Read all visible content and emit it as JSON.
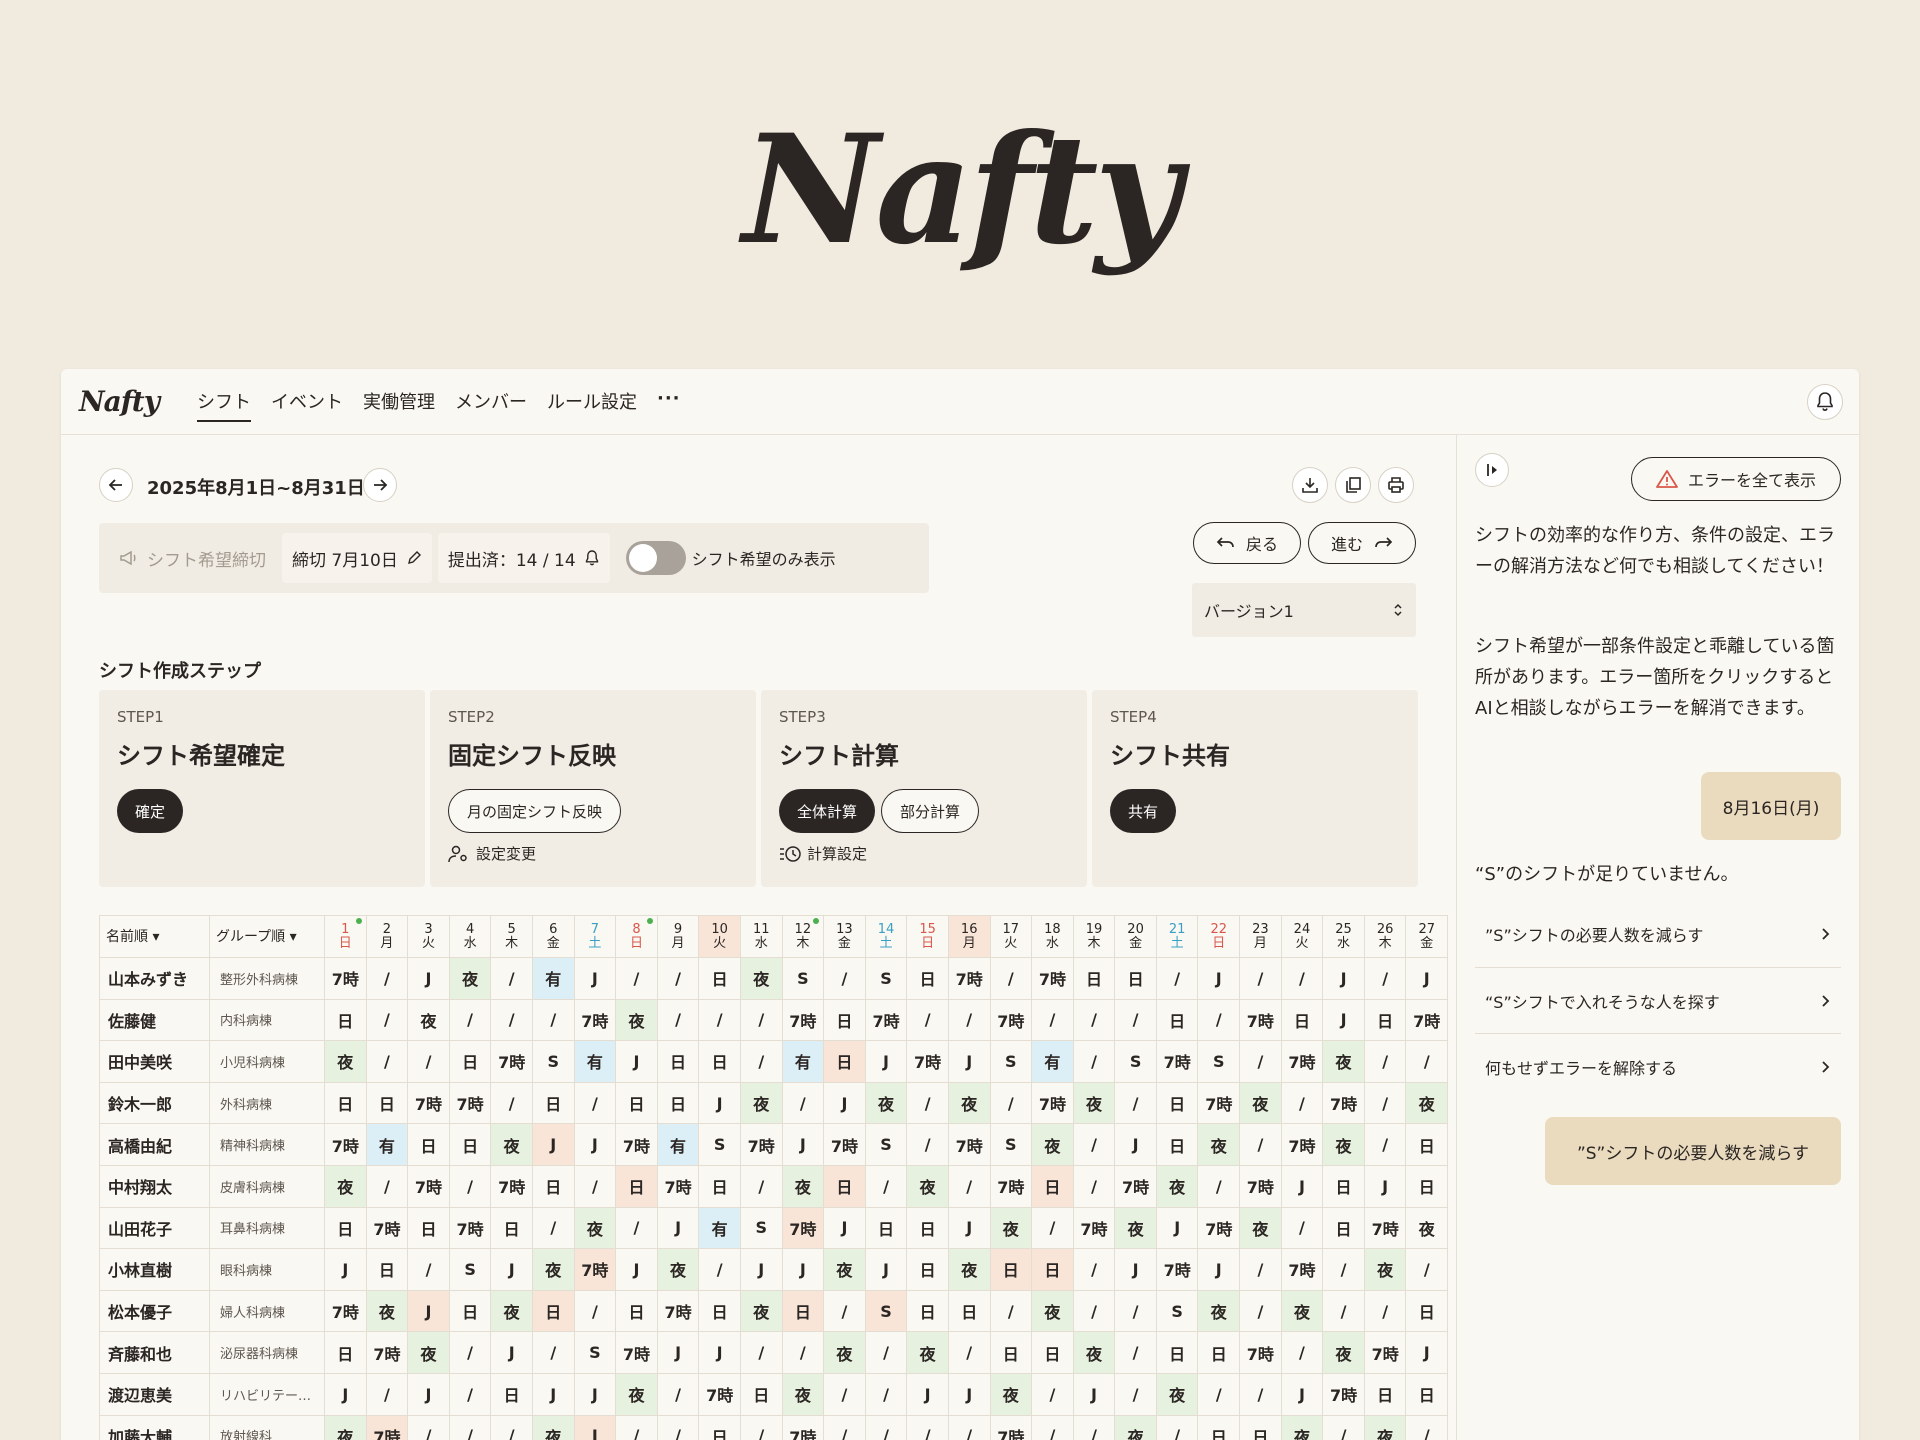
{
  "hero_logo": "Nafty",
  "app": {
    "logo": "Nafty",
    "nav": [
      "シフト",
      "イベント",
      "実働管理",
      "メンバー",
      "ルール設定",
      "···"
    ],
    "date_range": "2025年8月1日~8月31日",
    "info": {
      "deadline_label": "シフト希望締切",
      "deadline_value": "締切  7月10日",
      "submitted": "提出済：14 / 14",
      "toggle_label": "シフト希望のみ表示"
    },
    "undo_label": "戻る",
    "redo_label": "進む",
    "version": "バージョン1",
    "steps_title": "シフト作成ステップ",
    "steps": [
      {
        "label": "STEP1",
        "title": "シフト希望確定",
        "buttons": [
          {
            "text": "確定",
            "style": "dark"
          }
        ],
        "sub": ""
      },
      {
        "label": "STEP2",
        "title": "固定シフト反映",
        "buttons": [
          {
            "text": "月の固定シフト反映",
            "style": "light"
          }
        ],
        "sub": "設定変更"
      },
      {
        "label": "STEP3",
        "title": "シフト計算",
        "buttons": [
          {
            "text": "全体計算",
            "style": "dark"
          },
          {
            "text": "部分計算",
            "style": "light"
          }
        ],
        "sub": "計算設定"
      },
      {
        "label": "STEP4",
        "title": "シフト共有",
        "buttons": [
          {
            "text": "共有",
            "style": "dark"
          }
        ],
        "sub": ""
      }
    ],
    "table": {
      "sort_name": "名前順 ▾",
      "sort_group": "グループ順 ▾",
      "days": [
        {
          "d": "1",
          "w": "日",
          "type": "sun",
          "dot": true
        },
        {
          "d": "2",
          "w": "月"
        },
        {
          "d": "3",
          "w": "火"
        },
        {
          "d": "4",
          "w": "水"
        },
        {
          "d": "5",
          "w": "木"
        },
        {
          "d": "6",
          "w": "金"
        },
        {
          "d": "7",
          "w": "土",
          "type": "sat"
        },
        {
          "d": "8",
          "w": "日",
          "type": "sun",
          "dot": true
        },
        {
          "d": "9",
          "w": "月"
        },
        {
          "d": "10",
          "w": "火",
          "hl": true
        },
        {
          "d": "11",
          "w": "水"
        },
        {
          "d": "12",
          "w": "木",
          "dot": true
        },
        {
          "d": "13",
          "w": "金"
        },
        {
          "d": "14",
          "w": "土",
          "type": "sat"
        },
        {
          "d": "15",
          "w": "日",
          "type": "sun"
        },
        {
          "d": "16",
          "w": "月",
          "hl": true
        },
        {
          "d": "17",
          "w": "火"
        },
        {
          "d": "18",
          "w": "水"
        },
        {
          "d": "19",
          "w": "木"
        },
        {
          "d": "20",
          "w": "金"
        },
        {
          "d": "21",
          "w": "土",
          "type": "sat"
        },
        {
          "d": "22",
          "w": "日",
          "type": "sun"
        },
        {
          "d": "23",
          "w": "月"
        },
        {
          "d": "24",
          "w": "火"
        },
        {
          "d": "25",
          "w": "水"
        },
        {
          "d": "26",
          "w": "木"
        },
        {
          "d": "27",
          "w": "金"
        }
      ],
      "rows": [
        {
          "name": "山本みずき",
          "group": "整形外科病棟",
          "cells": [
            "7時",
            "/",
            "J",
            "夜",
            "/",
            "有",
            "J",
            "/",
            "/",
            "日",
            "夜",
            "S",
            "/",
            "S",
            "日",
            "7時",
            "/",
            "7時",
            "日",
            "日",
            "/",
            "J",
            "/",
            "/",
            "J",
            "/",
            "J"
          ],
          "colors": [
            "",
            "",
            "",
            "g",
            "",
            "b",
            "",
            "",
            "",
            "",
            "g",
            "",
            "",
            "",
            "",
            "",
            "",
            "",
            "",
            "",
            "",
            "",
            "",
            "",
            "",
            "",
            ""
          ]
        },
        {
          "name": "佐藤健",
          "group": "内科病棟",
          "cells": [
            "日",
            "/",
            "夜",
            "/",
            "/",
            "/",
            "7時",
            "夜",
            "/",
            "/",
            "/",
            "7時",
            "日",
            "7時",
            "/",
            "/",
            "7時",
            "/",
            "/",
            "/",
            "日",
            "/",
            "7時",
            "日",
            "J",
            "日",
            "7時"
          ],
          "colors": [
            "",
            "",
            "",
            "",
            "",
            "",
            "",
            "g",
            "",
            "",
            "",
            "",
            "",
            "",
            "",
            "",
            "",
            "",
            "",
            "",
            "",
            "",
            "",
            "",
            "",
            "",
            ""
          ]
        },
        {
          "name": "田中美咲",
          "group": "小児科病棟",
          "cells": [
            "夜",
            "/",
            "/",
            "日",
            "7時",
            "S",
            "有",
            "J",
            "日",
            "日",
            "/",
            "有",
            "日",
            "J",
            "7時",
            "J",
            "S",
            "有",
            "/",
            "S",
            "7時",
            "S",
            "/",
            "7時",
            "夜",
            "/",
            "/"
          ],
          "colors": [
            "g",
            "",
            "",
            "",
            "",
            "",
            "b",
            "",
            "",
            "",
            "",
            "b",
            "p",
            "",
            "",
            "",
            "",
            "b",
            "",
            "",
            "",
            "",
            "",
            "",
            "g",
            "",
            ""
          ]
        },
        {
          "name": "鈴木一郎",
          "group": "外科病棟",
          "cells": [
            "日",
            "日",
            "7時",
            "7時",
            "/",
            "日",
            "/",
            "日",
            "日",
            "J",
            "夜",
            "/",
            "J",
            "夜",
            "/",
            "夜",
            "/",
            "7時",
            "夜",
            "/",
            "日",
            "7時",
            "夜",
            "/",
            "7時",
            "/",
            "夜"
          ],
          "colors": [
            "",
            "",
            "",
            "",
            "",
            "",
            "",
            "",
            "",
            "",
            "g",
            "",
            "",
            "g",
            "",
            "g",
            "",
            "",
            "g",
            "",
            "",
            "",
            "g",
            "",
            "",
            "",
            "g"
          ]
        },
        {
          "name": "高橋由紀",
          "group": "精神科病棟",
          "cells": [
            "7時",
            "有",
            "日",
            "日",
            "夜",
            "J",
            "J",
            "7時",
            "有",
            "S",
            "7時",
            "J",
            "7時",
            "S",
            "/",
            "7時",
            "S",
            "夜",
            "/",
            "J",
            "日",
            "夜",
            "/",
            "7時",
            "夜",
            "/",
            "日"
          ],
          "colors": [
            "",
            "b",
            "",
            "",
            "g",
            "p",
            "",
            "",
            "b",
            "",
            "",
            "",
            "",
            "",
            "",
            "",
            "",
            "g",
            "",
            "",
            "",
            "g",
            "",
            "",
            "g",
            "",
            ""
          ]
        },
        {
          "name": "中村翔太",
          "group": "皮膚科病棟",
          "cells": [
            "夜",
            "/",
            "7時",
            "/",
            "7時",
            "日",
            "/",
            "日",
            "7時",
            "日",
            "/",
            "夜",
            "日",
            "/",
            "夜",
            "/",
            "7時",
            "日",
            "/",
            "7時",
            "夜",
            "/",
            "7時",
            "J",
            "日",
            "J",
            "日"
          ],
          "colors": [
            "g",
            "",
            "",
            "",
            "",
            "",
            "",
            "p",
            "",
            "",
            "",
            "g",
            "p",
            "",
            "g",
            "",
            "",
            "p",
            "",
            "",
            "g",
            "",
            "",
            "",
            "",
            "",
            ""
          ]
        },
        {
          "name": "山田花子",
          "group": "耳鼻科病棟",
          "cells": [
            "日",
            "7時",
            "日",
            "7時",
            "日",
            "/",
            "夜",
            "/",
            "J",
            "有",
            "S",
            "7時",
            "J",
            "日",
            "日",
            "J",
            "夜",
            "/",
            "7時",
            "夜",
            "J",
            "7時",
            "夜",
            "/",
            "日",
            "7時",
            "夜"
          ],
          "colors": [
            "",
            "",
            "",
            "",
            "",
            "",
            "g",
            "",
            "",
            "b",
            "",
            "p",
            "",
            "",
            "",
            "",
            "g",
            "",
            "",
            "g",
            "",
            "",
            "g",
            "",
            "",
            "",
            ""
          ]
        },
        {
          "name": "小林直樹",
          "group": "眼科病棟",
          "cells": [
            "J",
            "日",
            "/",
            "S",
            "J",
            "夜",
            "7時",
            "J",
            "夜",
            "/",
            "J",
            "J",
            "夜",
            "J",
            "日",
            "夜",
            "日",
            "日",
            "/",
            "J",
            "7時",
            "J",
            "/",
            "7時",
            "/",
            "夜",
            "/"
          ],
          "colors": [
            "",
            "",
            "",
            "",
            "",
            "g",
            "p",
            "",
            "g",
            "",
            "",
            "",
            "g",
            "",
            "",
            "g",
            "p",
            "p",
            "",
            "",
            "",
            "",
            "",
            "",
            "",
            "g",
            ""
          ]
        },
        {
          "name": "松本優子",
          "group": "婦人科病棟",
          "cells": [
            "7時",
            "夜",
            "J",
            "日",
            "夜",
            "日",
            "/",
            "日",
            "7時",
            "日",
            "夜",
            "日",
            "/",
            "S",
            "日",
            "日",
            "/",
            "夜",
            "/",
            "/",
            "S",
            "夜",
            "/",
            "夜",
            "/",
            "/",
            "日"
          ],
          "colors": [
            "",
            "g",
            "p",
            "",
            "g",
            "p",
            "",
            "",
            "",
            "",
            "g",
            "p",
            "",
            "p",
            "",
            "",
            "",
            "g",
            "",
            "",
            "",
            "g",
            "",
            "g",
            "",
            "",
            ""
          ]
        },
        {
          "name": "斉藤和也",
          "group": "泌尿器科病棟",
          "cells": [
            "日",
            "7時",
            "夜",
            "/",
            "J",
            "/",
            "S",
            "7時",
            "J",
            "J",
            "/",
            "/",
            "夜",
            "/",
            "夜",
            "/",
            "日",
            "日",
            "夜",
            "/",
            "日",
            "日",
            "7時",
            "/",
            "夜",
            "7時",
            "J"
          ],
          "colors": [
            "",
            "",
            "g",
            "",
            "",
            "",
            "",
            "",
            "",
            "",
            "",
            "",
            "g",
            "",
            "g",
            "",
            "",
            "",
            "g",
            "",
            "",
            "",
            "",
            "",
            "g",
            "",
            ""
          ]
        },
        {
          "name": "渡辺恵美",
          "group": "リハビリテー…",
          "cells": [
            "J",
            "/",
            "J",
            "/",
            "日",
            "J",
            "J",
            "夜",
            "/",
            "7時",
            "日",
            "夜",
            "/",
            "/",
            "J",
            "J",
            "夜",
            "/",
            "J",
            "/",
            "夜",
            "/",
            "/",
            "J",
            "7時",
            "日",
            "日"
          ],
          "colors": [
            "",
            "",
            "",
            "",
            "",
            "",
            "",
            "g",
            "",
            "",
            "",
            "g",
            "",
            "",
            "",
            "",
            "g",
            "",
            "",
            "",
            "g",
            "",
            "",
            "",
            "",
            "",
            ""
          ]
        },
        {
          "name": "加藤大輔",
          "group": "放射線科",
          "cells": [
            "夜",
            "7時",
            "/",
            "/",
            "/",
            "夜",
            "J",
            "/",
            "/",
            "日",
            "/",
            "7時",
            "/",
            "/",
            "/",
            "/",
            "7時",
            "/",
            "/",
            "夜",
            "/",
            "日",
            "日",
            "夜",
            "/",
            "夜",
            "/"
          ],
          "colors": [
            "g",
            "p",
            "",
            "",
            "",
            "g",
            "p",
            "",
            "",
            "",
            "",
            "",
            "",
            "",
            "",
            "",
            "",
            "",
            "",
            "g",
            "",
            "",
            "",
            "g",
            "",
            "g",
            ""
          ]
        }
      ]
    }
  },
  "sidebar": {
    "error_button": "エラーを全て表示",
    "intro": "シフトの効率的な作り方、条件の設定、エラーの解消方法など何でも相談してください！",
    "notice": "シフト希望が一部条件設定と乖離している箇所があります。エラー箇所をクリックするとAIと相談しながらエラーを解消できます。",
    "user_date": "8月16日(月)",
    "missing": "“S”のシフトが足りていません。",
    "suggestions": [
      "”S”シフトの必要人数を減らす",
      "“S”シフトで入れそうな人を探す",
      "何もせずエラーを解除する"
    ],
    "user_reply": "”S”シフトの必要人数を減らす"
  }
}
